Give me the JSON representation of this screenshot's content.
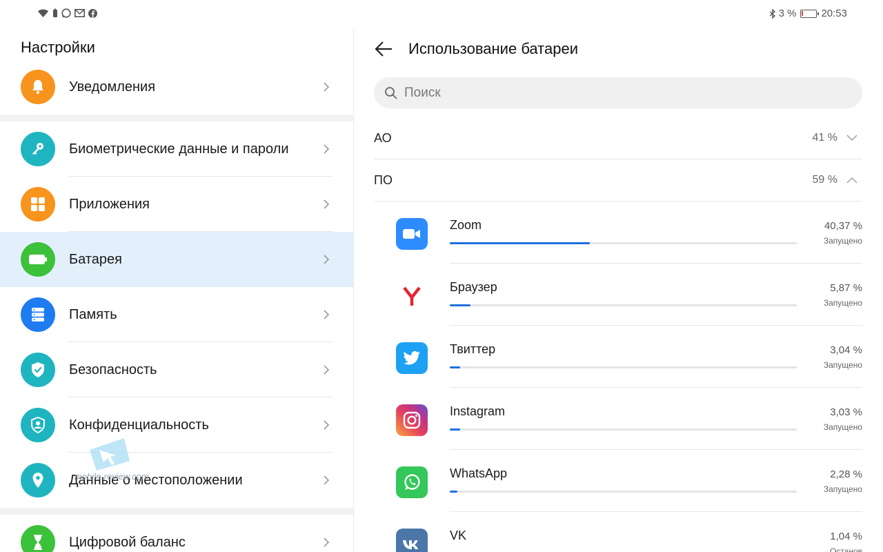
{
  "status_bar": {
    "battery_percent": "3 %",
    "time": "20:53",
    "left_icons": [
      "wifi-icon",
      "battery-saver-icon",
      "whatsapp-notification-icon",
      "mail-icon",
      "facebook-icon"
    ],
    "right_icons": [
      "bluetooth-icon",
      "battery-icon"
    ]
  },
  "settings": {
    "title": "Настройки",
    "items": [
      {
        "label": "Уведомления",
        "icon": "bell-icon",
        "color": "#f7941d"
      },
      {
        "label": "Биометрические данные и пароли",
        "icon": "key-icon",
        "color": "#1fb5c0"
      },
      {
        "label": "Приложения",
        "icon": "apps-grid-icon",
        "color": "#f7941d"
      },
      {
        "label": "Батарея",
        "icon": "battery-icon",
        "color": "#3cc13b"
      },
      {
        "label": "Память",
        "icon": "storage-icon",
        "color": "#1e7cf0"
      },
      {
        "label": "Безопасность",
        "icon": "shield-check-icon",
        "color": "#1fb5c0"
      },
      {
        "label": "Конфиденциальность",
        "icon": "privacy-shield-icon",
        "color": "#1fb5c0"
      },
      {
        "label": "Данные о местоположении",
        "icon": "location-pin-icon",
        "color": "#1fb5c0"
      },
      {
        "label": "Цифровой баланс",
        "icon": "hourglass-icon",
        "color": "#3cc13b"
      }
    ],
    "active_item": "Батарея"
  },
  "watermark": {
    "text": "mobile-review.com"
  },
  "battery_usage": {
    "title": "Использование батареи",
    "search_placeholder": "Поиск",
    "sections": [
      {
        "label": "АО",
        "percent": "41 %",
        "expanded": false
      },
      {
        "label": "ПО",
        "percent": "59 %",
        "expanded": true
      }
    ],
    "apps": [
      {
        "name": "Zoom",
        "percent": "40,37 %",
        "status": "Запущено",
        "share": 0.4037,
        "icon": "zoom-icon"
      },
      {
        "name": "Браузер",
        "percent": "5,87 %",
        "status": "Запущено",
        "share": 0.0587,
        "icon": "yandex-browser-icon"
      },
      {
        "name": "Твиттер",
        "percent": "3,04 %",
        "status": "Запущено",
        "share": 0.0304,
        "icon": "twitter-icon"
      },
      {
        "name": "Instagram",
        "percent": "3,03 %",
        "status": "Запущено",
        "share": 0.0303,
        "icon": "instagram-icon"
      },
      {
        "name": "WhatsApp",
        "percent": "2,28 %",
        "status": "Запущено",
        "share": 0.0228,
        "icon": "whatsapp-icon"
      },
      {
        "name": "VK",
        "percent": "1,04 %",
        "status": "Останов",
        "share": 0.0104,
        "icon": "vk-icon"
      }
    ]
  },
  "colors": {
    "accent": "#1e6fe0",
    "active_bg": "#e3f0fc"
  }
}
